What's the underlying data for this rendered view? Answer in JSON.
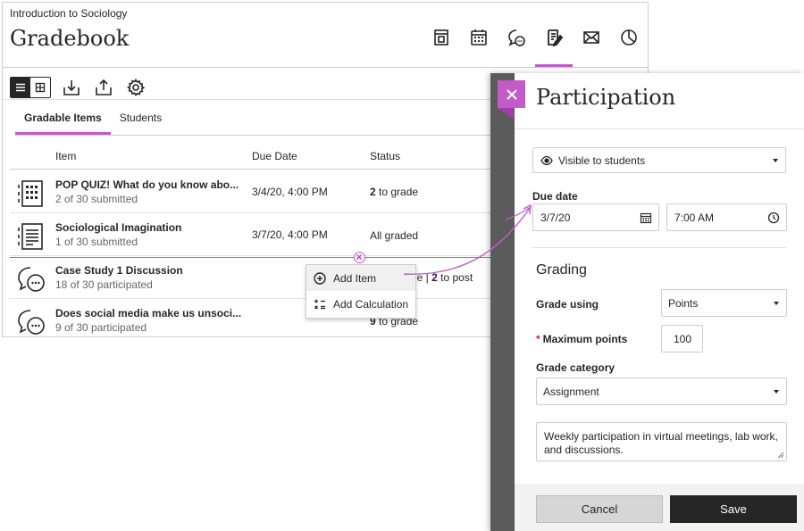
{
  "colors": {
    "accent": "#c25ac8",
    "dark": "#262626",
    "required": "#c9272c"
  },
  "gradebook": {
    "course_name": "Introduction to Sociology",
    "title": "Gradebook",
    "top_icons": [
      "book-icon",
      "calendar-icon",
      "discussion-icon",
      "gradebook-icon",
      "mail-icon",
      "analytics-icon"
    ],
    "active_icon": "gradebook-icon",
    "toolbar_icons": [
      "list-view-icon",
      "grid-view-icon",
      "download-icon",
      "upload-icon",
      "settings-icon"
    ],
    "tabs": [
      {
        "label": "Gradable Items",
        "active": true
      },
      {
        "label": "Students",
        "active": false
      }
    ],
    "columns": {
      "item": "Item",
      "due": "Due Date",
      "status": "Status"
    },
    "rows": [
      {
        "icon": "test-icon",
        "name": "POP QUIZ! What do you know abo...",
        "sub": "2 of 30 submitted",
        "due": "3/4/20, 4:00 PM",
        "status_bold": "2",
        "status_rest": " to grade"
      },
      {
        "icon": "assignment-icon",
        "name": "Sociological Imagination",
        "sub": "1 of 30 submitted",
        "due": "3/7/20, 4:00 PM",
        "status_bold": "",
        "status_rest": "All graded"
      },
      {
        "icon": "discussion-icon",
        "name": "Case Study 1 Discussion",
        "sub": "18 of 30 participated",
        "due": "",
        "status_bold": "",
        "status_rest": "de | ",
        "status_bold2": "2",
        "status_rest2": " to post"
      },
      {
        "icon": "discussion-icon",
        "name": "Does social media make us unsoci...",
        "sub": "9 of 30 participated",
        "due": "",
        "status_bold": "9",
        "status_rest": " to grade"
      }
    ],
    "context_menu": [
      {
        "icon": "add-circle-icon",
        "label": "Add Item"
      },
      {
        "icon": "calculation-icon",
        "label": "Add Calculation"
      }
    ]
  },
  "panel": {
    "title": "Participation",
    "visibility": "Visible to students",
    "due_date_label": "Due date",
    "due_date": "3/7/20",
    "due_time": "7:00 AM",
    "grading_title": "Grading",
    "grade_using_label": "Grade using",
    "grade_using": "Points",
    "max_points_label": "Maximum points",
    "max_points_required": "*",
    "max_points": "100",
    "grade_category_label": "Grade category",
    "grade_category": "Assignment",
    "description": "Weekly participation in virtual meetings, lab work, and discussions.",
    "cancel_label": "Cancel",
    "save_label": "Save"
  }
}
